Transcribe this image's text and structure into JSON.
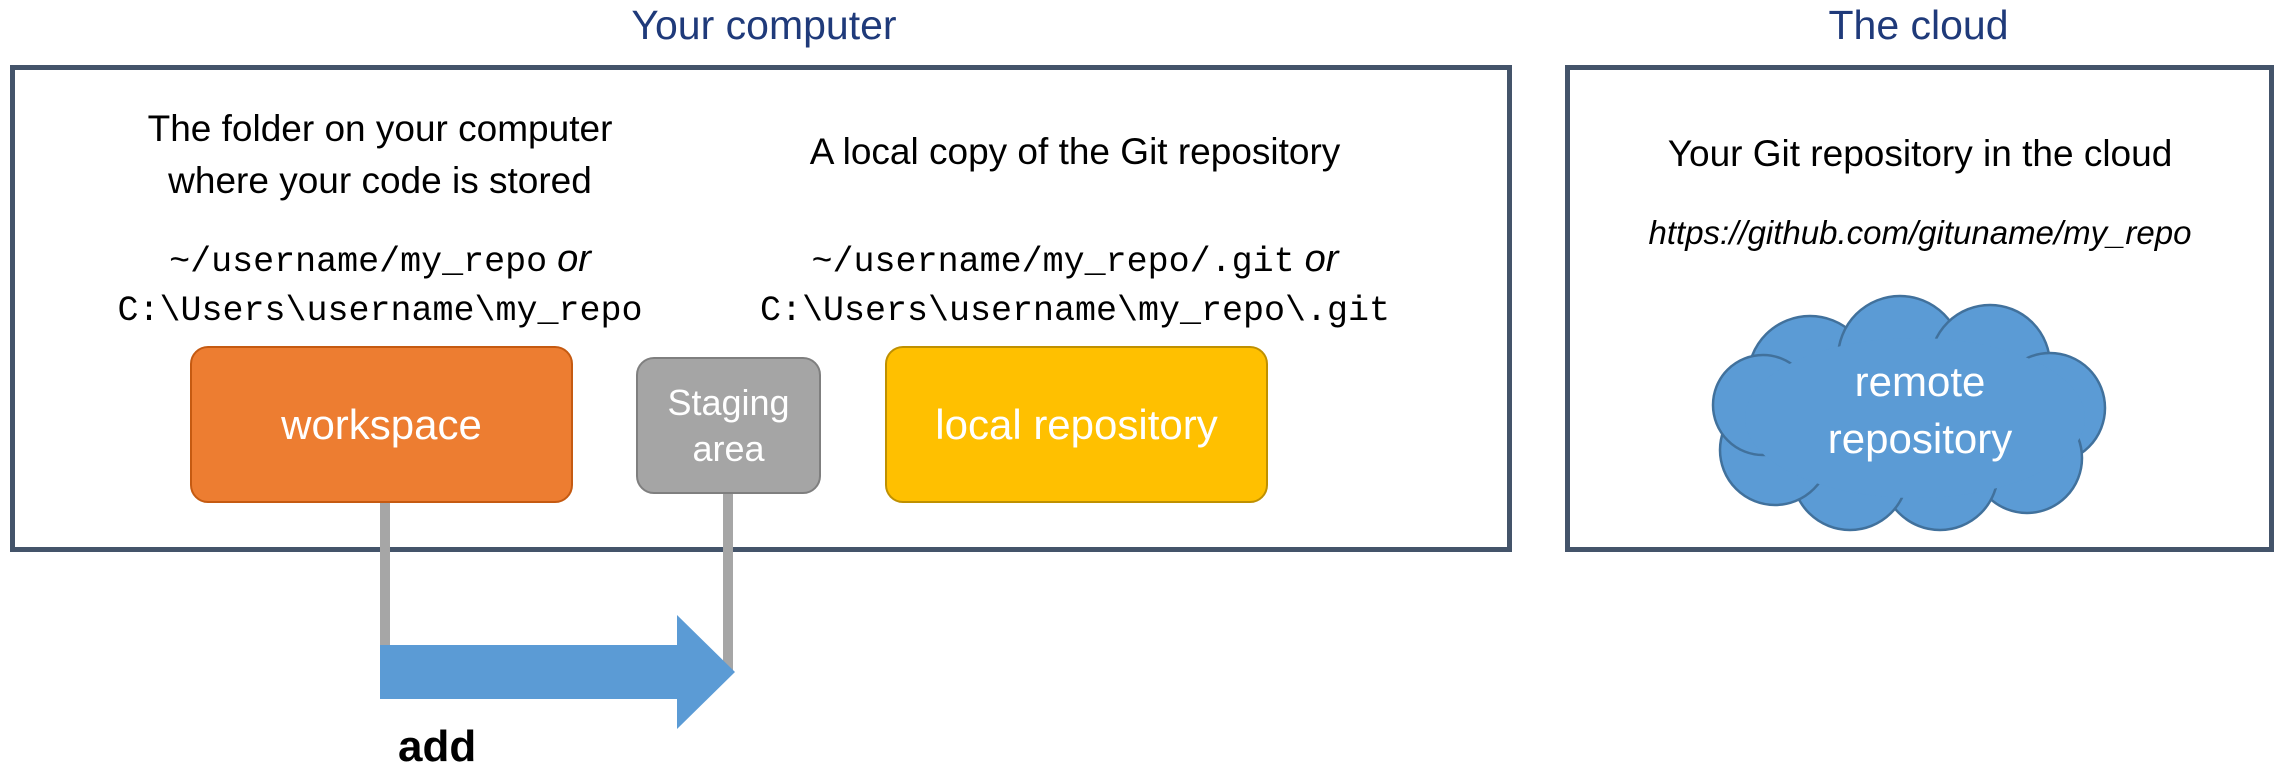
{
  "headings": {
    "computer": "Your computer",
    "cloud": "The cloud"
  },
  "workspace_section": {
    "description_line1": "The folder on your computer",
    "description_line2": "where your code is stored",
    "path_unix": "~/username/my_repo",
    "or_text": "or",
    "path_windows": "C:\\Users\\username\\my_repo"
  },
  "local_repo_section": {
    "description": "A local copy of the Git repository",
    "path_unix": "~/username/my_repo/.git",
    "or_text": "or",
    "path_windows": "C:\\Users\\username\\my_repo\\.git"
  },
  "cloud_section": {
    "description": "Your Git repository in the cloud",
    "url": "https://github.com/gituname/my_repo"
  },
  "nodes": {
    "workspace": "workspace",
    "staging_line1": "Staging",
    "staging_line2": "area",
    "local_repository": "local repository",
    "remote_line1": "remote",
    "remote_line2": "repository"
  },
  "arrow_label": "add",
  "colors": {
    "frame_border": "#44546a",
    "heading_text": "#1f3a7a",
    "workspace_fill": "#ed7d31",
    "staging_fill": "#a5a5a5",
    "local_repo_fill": "#ffc000",
    "remote_fill": "#5b9bd5",
    "arrow_fill": "#5b9bd5",
    "connector": "#a6a6a6"
  }
}
